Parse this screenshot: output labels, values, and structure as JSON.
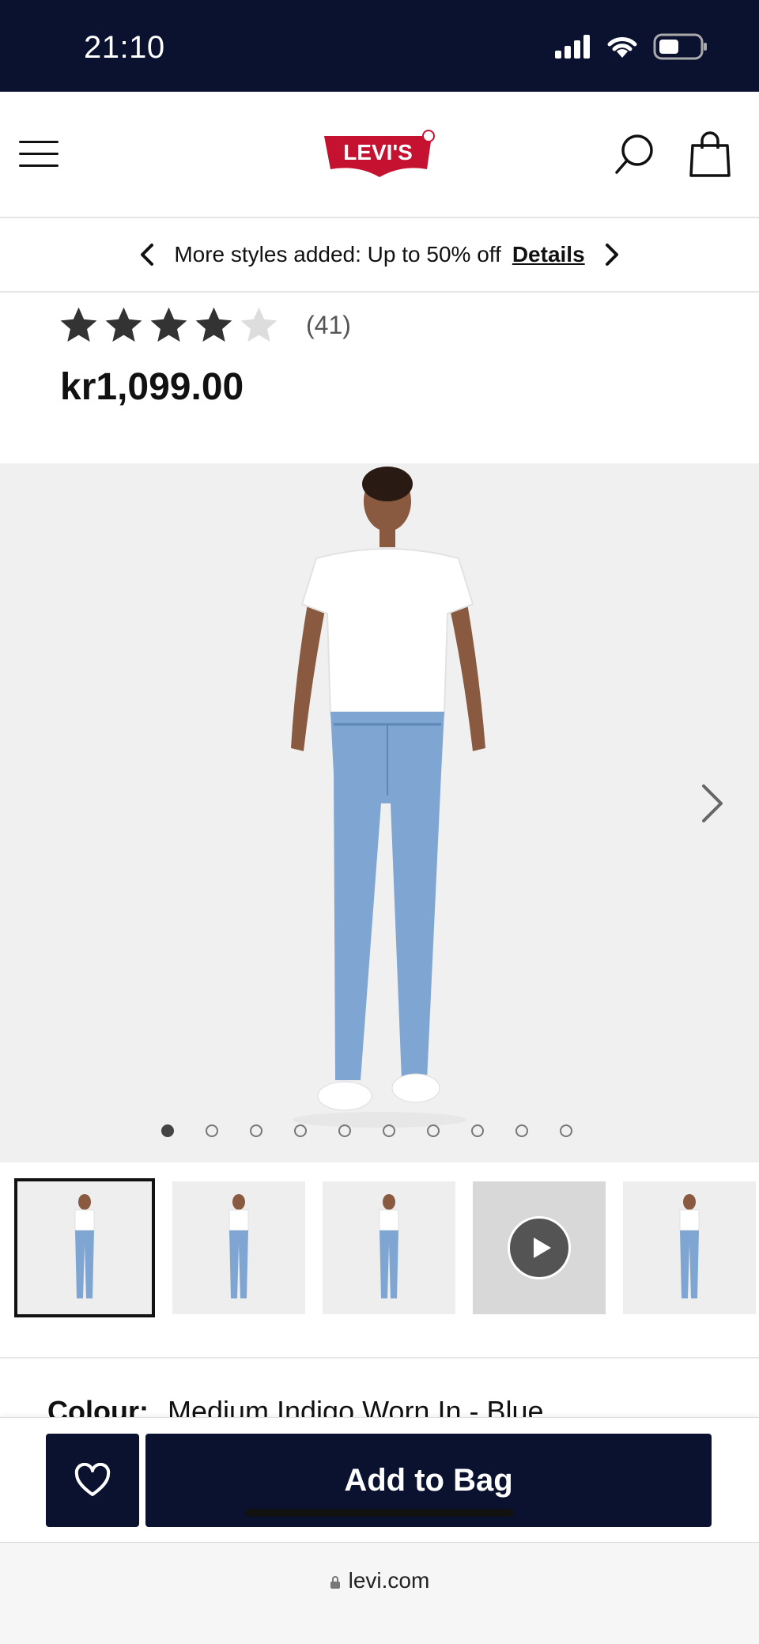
{
  "status_bar": {
    "time": "21:10"
  },
  "header": {
    "logo_text": "LEVI'S",
    "icons": [
      "menu-icon",
      "search-icon",
      "shopping-bag-icon"
    ]
  },
  "promo": {
    "text": "More styles added: Up to 50% off",
    "link": "Details"
  },
  "product": {
    "rating": 4,
    "rating_max": 5,
    "review_count": "(41)",
    "price": "kr1,099.00"
  },
  "gallery": {
    "image_count": 10,
    "active_index": 0
  },
  "thumbnails": [
    {
      "kind": "image",
      "selected": true
    },
    {
      "kind": "image",
      "selected": false
    },
    {
      "kind": "image",
      "selected": false
    },
    {
      "kind": "video",
      "selected": false
    },
    {
      "kind": "image",
      "selected": false
    }
  ],
  "colour": {
    "label": "Colour:",
    "value": "Medium Indigo Worn In - Blue"
  },
  "actions": {
    "add_to_bag": "Add to Bag"
  },
  "browser": {
    "url": "levi.com"
  },
  "colors": {
    "navy": "#0b1230",
    "brand_red": "#c41230",
    "star_filled": "#333333",
    "star_empty": "#dddddd"
  }
}
